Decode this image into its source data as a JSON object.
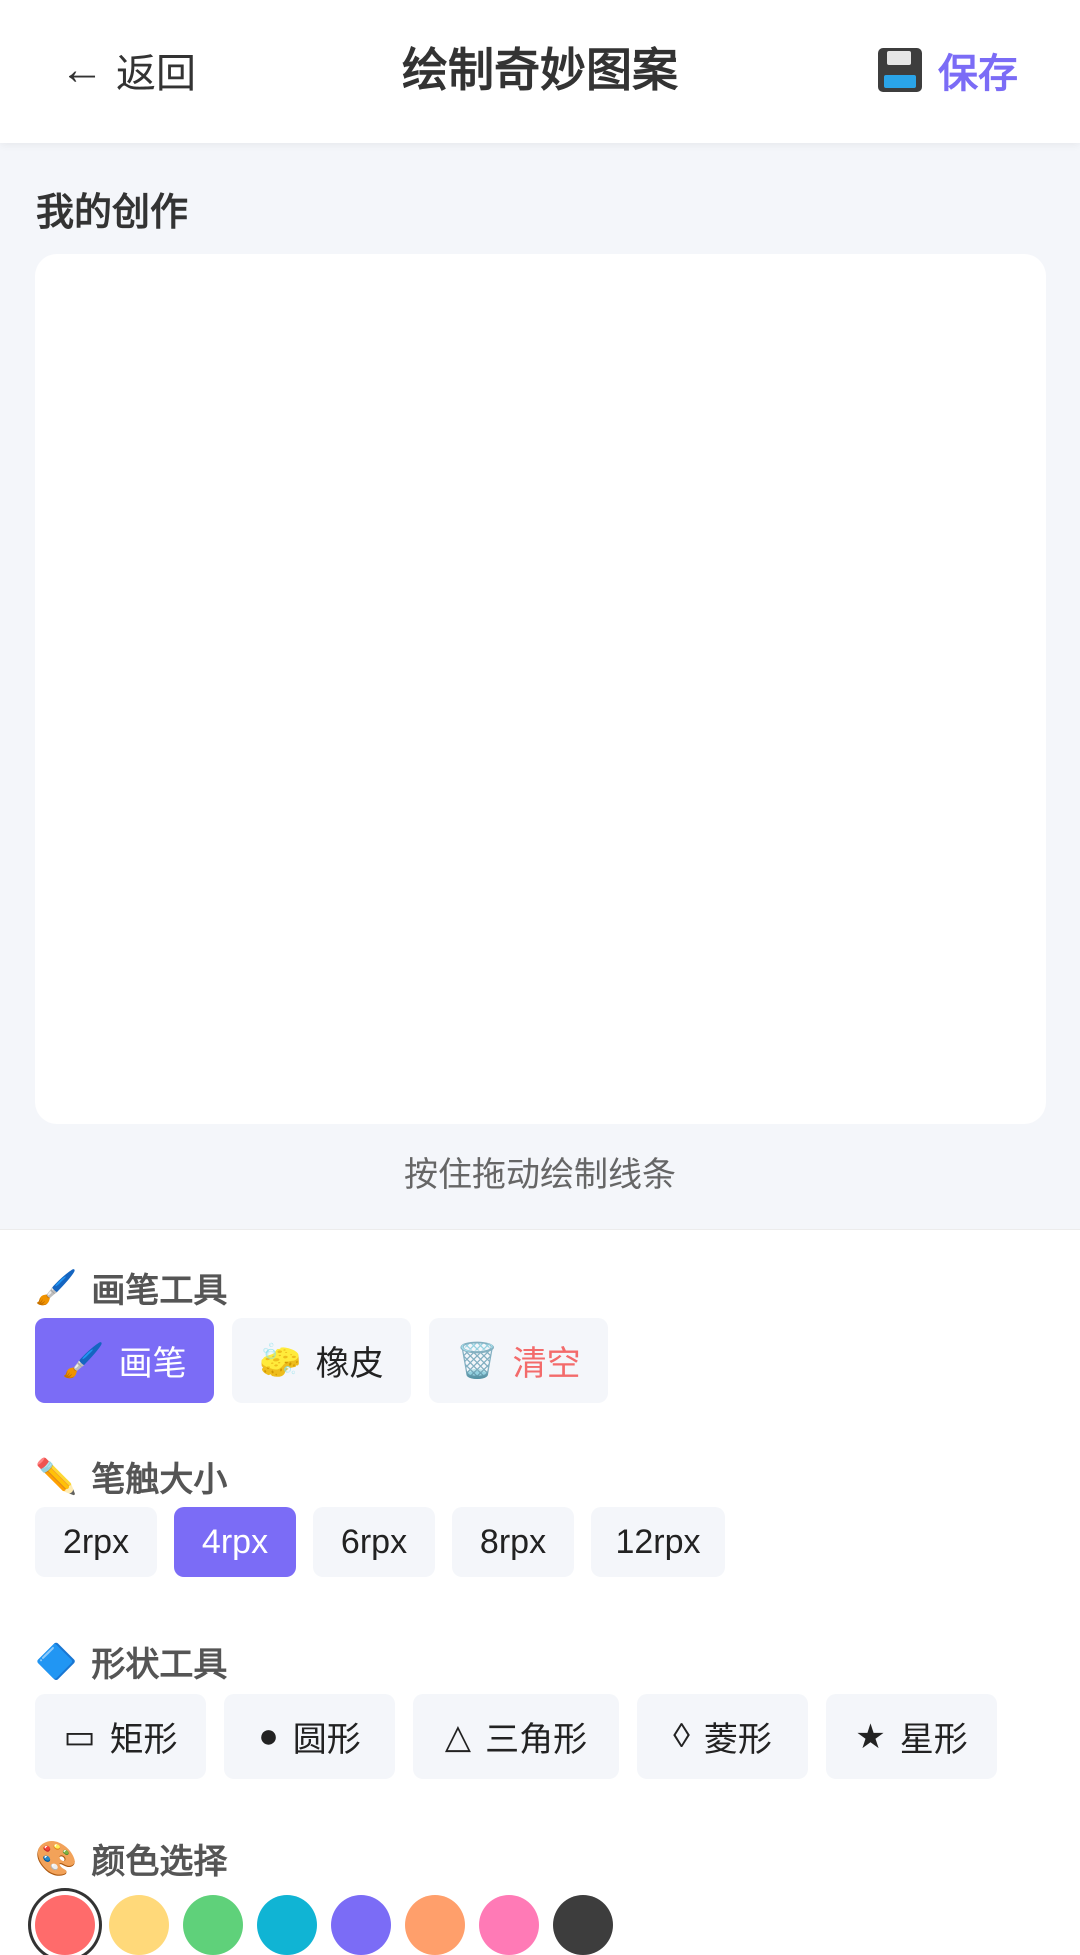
{
  "header": {
    "back_arrow": "←",
    "back_label": "返回",
    "title": "绘制奇妙图案",
    "save_label": "保存"
  },
  "canvas": {
    "heading": "我的创作",
    "hint": "按住拖动绘制线条"
  },
  "brush_tools": {
    "label_icon": "🖌️",
    "label": "画笔工具",
    "items": [
      {
        "icon": "🖌️",
        "label": "画笔",
        "active": true
      },
      {
        "icon": "🧽",
        "label": "橡皮",
        "active": false
      },
      {
        "icon": "🗑️",
        "label": "清空",
        "active": false
      }
    ]
  },
  "stroke_size": {
    "label_icon": "✏️",
    "label": "笔触大小",
    "items": [
      {
        "label": "2rpx",
        "active": false
      },
      {
        "label": "4rpx",
        "active": true
      },
      {
        "label": "6rpx",
        "active": false
      },
      {
        "label": "8rpx",
        "active": false
      },
      {
        "label": "12rpx",
        "active": false
      }
    ]
  },
  "shape_tools": {
    "label_icon": "🔷",
    "label": "形状工具",
    "items": [
      {
        "icon": "▭",
        "label": "矩形"
      },
      {
        "icon": "●",
        "label": "圆形"
      },
      {
        "icon": "△",
        "label": "三角形"
      },
      {
        "icon": "◊",
        "label": "菱形"
      },
      {
        "icon": "★",
        "label": "星形"
      }
    ]
  },
  "color_picker": {
    "label_icon": "🎨",
    "label": "颜色选择",
    "selected_index": 0,
    "swatches": [
      "#ff6b6b",
      "#ffd97a",
      "#5fd17a",
      "#10b4d4",
      "#7b6cf6",
      "#ff9f6b",
      "#ff7ab6",
      "#3d3d3d"
    ]
  },
  "colors": {
    "accent": "#7b6cf6",
    "danger": "#f36b6b"
  }
}
